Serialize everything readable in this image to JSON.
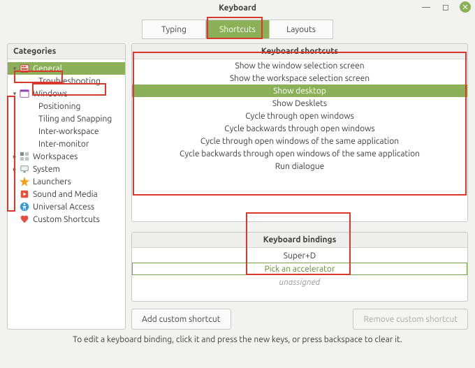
{
  "window": {
    "title": "Keyboard"
  },
  "tabs": [
    {
      "label": "Typing",
      "active": false
    },
    {
      "label": "Shortcuts",
      "active": true
    },
    {
      "label": "Layouts",
      "active": false
    }
  ],
  "categories_header": "Categories",
  "categories": [
    {
      "label": "General",
      "indent": 0,
      "expander": "▾",
      "icon": "general",
      "selected": true
    },
    {
      "label": "Troubleshooting",
      "indent": 1,
      "expander": "",
      "icon": "",
      "selected": false
    },
    {
      "label": "Windows",
      "indent": 0,
      "expander": "▾",
      "icon": "windows",
      "selected": false
    },
    {
      "label": "Positioning",
      "indent": 1,
      "expander": "",
      "icon": "",
      "selected": false
    },
    {
      "label": "Tiling and Snapping",
      "indent": 1,
      "expander": "",
      "icon": "",
      "selected": false
    },
    {
      "label": "Inter-workspace",
      "indent": 1,
      "expander": "",
      "icon": "",
      "selected": false
    },
    {
      "label": "Inter-monitor",
      "indent": 1,
      "expander": "",
      "icon": "",
      "selected": false
    },
    {
      "label": "Workspaces",
      "indent": 0,
      "expander": "▸",
      "icon": "workspaces",
      "selected": false
    },
    {
      "label": "System",
      "indent": 0,
      "expander": "▸",
      "icon": "system",
      "selected": false
    },
    {
      "label": "Launchers",
      "indent": 0,
      "expander": "",
      "icon": "launchers",
      "selected": false
    },
    {
      "label": "Sound and Media",
      "indent": 0,
      "expander": "",
      "icon": "sound",
      "selected": false
    },
    {
      "label": "Universal Access",
      "indent": 0,
      "expander": "",
      "icon": "ua",
      "selected": false
    },
    {
      "label": "Custom Shortcuts",
      "indent": 0,
      "expander": "",
      "icon": "custom",
      "selected": false
    }
  ],
  "shortcuts_header": "Keyboard shortcuts",
  "shortcuts": [
    {
      "label": "Show the window selection screen",
      "selected": false
    },
    {
      "label": "Show the workspace selection screen",
      "selected": false
    },
    {
      "label": "Show desktop",
      "selected": true
    },
    {
      "label": "Show Desklets",
      "selected": false
    },
    {
      "label": "Cycle through open windows",
      "selected": false
    },
    {
      "label": "Cycle backwards through open windows",
      "selected": false
    },
    {
      "label": "Cycle through open windows of the same application",
      "selected": false
    },
    {
      "label": "Cycle backwards through open windows of the same application",
      "selected": false
    },
    {
      "label": "Run dialogue",
      "selected": false
    }
  ],
  "bindings_header": "Keyboard bindings",
  "bindings": [
    {
      "label": "Super+D",
      "state": "normal"
    },
    {
      "label": "Pick an accelerator",
      "state": "editing"
    },
    {
      "label": "unassigned",
      "state": "unassigned"
    }
  ],
  "buttons": {
    "add": "Add custom shortcut",
    "remove": "Remove custom shortcut"
  },
  "hint": "To edit a keyboard binding, click it and press the new keys, or press backspace to clear it.",
  "icons": {
    "general": "<svg viewBox='0 0 16 16'><rect x='1' y='2' width='14' height='12' rx='2' fill='#f2dede' stroke='#c0392b'/><rect x='3' y='4' width='3' height='2' fill='#c0392b'/><rect x='7' y='4' width='3' height='2' fill='#c0392b'/><rect x='3' y='8' width='10' height='2' fill='#c0392b'/></svg>",
    "windows": "<svg viewBox='0 0 16 16'><rect x='1' y='2' width='14' height='12' rx='1' fill='#fff' stroke='#8e44ad'/><rect x='1' y='2' width='14' height='3' fill='#8e44ad'/></svg>",
    "workspaces": "<svg viewBox='0 0 16 16'><rect x='1' y='1' width='6' height='6' fill='#7f8c8d'/><rect x='9' y='1' width='6' height='6' fill='#bdc3c7'/><rect x='1' y='9' width='6' height='6' fill='#bdc3c7'/><rect x='9' y='9' width='6' height='6' fill='#bdc3c7'/></svg>",
    "system": "<svg viewBox='0 0 16 16'><rect x='2' y='3' width='12' height='8' rx='1' fill='#ecf0f1' stroke='#7f8c8d'/><rect x='6' y='12' width='4' height='2' fill='#7f8c8d'/></svg>",
    "launchers": "<svg viewBox='0 0 16 16'><path d='M8 0 L10 6 L16 6 L11 10 L13 16 L8 12 L3 16 L5 10 L0 6 L6 6 Z' fill='#f39c12'/></svg>",
    "sound": "<svg viewBox='0 0 16 16'><rect x='2' y='2' width='12' height='12' rx='2' fill='#e74c3c'/><polygon points='6,5 6,11 11,8' fill='#fff'/></svg>",
    "ua": "<svg viewBox='0 0 16 16'><circle cx='8' cy='8' r='7' fill='#3498db'/><circle cx='8' cy='4' r='1.5' fill='#fff'/><path d='M4 7 L12 7 L10 8 L10 13 L9 13 L8.5 9 L7.5 9 L7 13 L6 13 L6 8 Z' fill='#fff'/></svg>",
    "custom": "<svg viewBox='0 0 16 16'><path d='M8 14 C4 10 2 8 2 5 C2 3 4 2 5.5 2 C7 2 8 3 8 3 C8 3 9 2 10.5 2 C12 2 14 3 14 5 C14 8 12 10 8 14 Z' fill='#e74c3c'/></svg>"
  }
}
